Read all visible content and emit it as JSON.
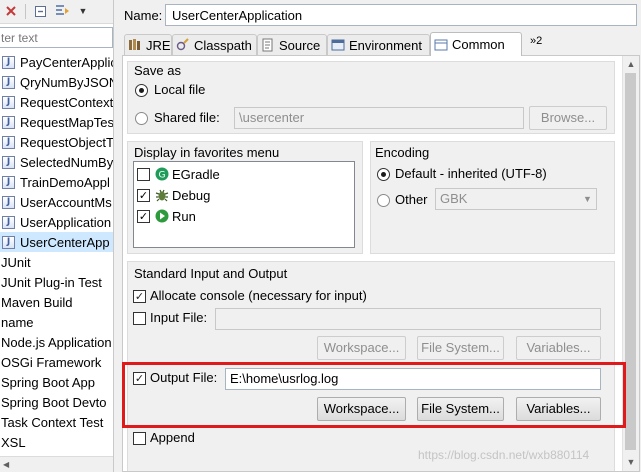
{
  "left": {
    "filter_placeholder": "ter text",
    "tree": [
      {
        "label": "PayCenterApplic",
        "child": true,
        "selected": false
      },
      {
        "label": "QryNumByJSON",
        "child": true,
        "selected": false
      },
      {
        "label": "RequestContext",
        "child": true,
        "selected": false
      },
      {
        "label": "RequestMapTes",
        "child": true,
        "selected": false
      },
      {
        "label": "RequestObjectT",
        "child": true,
        "selected": false
      },
      {
        "label": "SelectedNumBy",
        "child": true,
        "selected": false
      },
      {
        "label": "TrainDemoAppl",
        "child": true,
        "selected": false
      },
      {
        "label": "UserAccountMs",
        "child": true,
        "selected": false
      },
      {
        "label": "UserApplication",
        "child": true,
        "selected": false
      },
      {
        "label": "UserCenterApp",
        "child": true,
        "selected": true
      },
      {
        "label": "JUnit",
        "child": false,
        "selected": false
      },
      {
        "label": "JUnit Plug-in Test",
        "child": false,
        "selected": false
      },
      {
        "label": "Maven Build",
        "child": false,
        "selected": false
      },
      {
        "label": "name",
        "child": false,
        "selected": false
      },
      {
        "label": "Node.js Application",
        "child": false,
        "selected": false
      },
      {
        "label": "OSGi Framework",
        "child": false,
        "selected": false
      },
      {
        "label": "Spring Boot App",
        "child": false,
        "selected": false
      },
      {
        "label": "Spring Boot Devto",
        "child": false,
        "selected": false
      },
      {
        "label": "Task Context Test",
        "child": false,
        "selected": false
      },
      {
        "label": "XSL",
        "child": false,
        "selected": false
      }
    ]
  },
  "config": {
    "name_label": "Name:",
    "name_value": "UserCenterApplication"
  },
  "tabs": {
    "jre": "JRE",
    "classpath": "Classpath",
    "source": "Source",
    "environment": "Environment",
    "common": "Common",
    "overflow": "»2"
  },
  "common": {
    "save_as": {
      "title": "Save as",
      "local": "Local file",
      "shared": "Shared file:",
      "shared_path": "\\usercenter",
      "browse": "Browse..."
    },
    "favorites": {
      "title": "Display in favorites menu",
      "items": [
        {
          "label": "EGradle",
          "checked": false
        },
        {
          "label": "Debug",
          "checked": true
        },
        {
          "label": "Run",
          "checked": true
        }
      ]
    },
    "encoding": {
      "title": "Encoding",
      "default_label": "Default - inherited (UTF-8)",
      "other_label": "Other",
      "other_value": "GBK"
    },
    "io": {
      "title": "Standard Input and Output",
      "allocate_console": "Allocate console (necessary for input)",
      "input_file": "Input File:",
      "workspace": "Workspace...",
      "file_system": "File System...",
      "variables": "Variables...",
      "output_file": "Output File:",
      "output_value": "E:\\home\\usrlog.log",
      "append": "Append"
    }
  },
  "watermark": "https://blog.csdn.net/wxb880114",
  "colors": {
    "highlight": "#e01a1a",
    "selection": "#cde8ff"
  }
}
